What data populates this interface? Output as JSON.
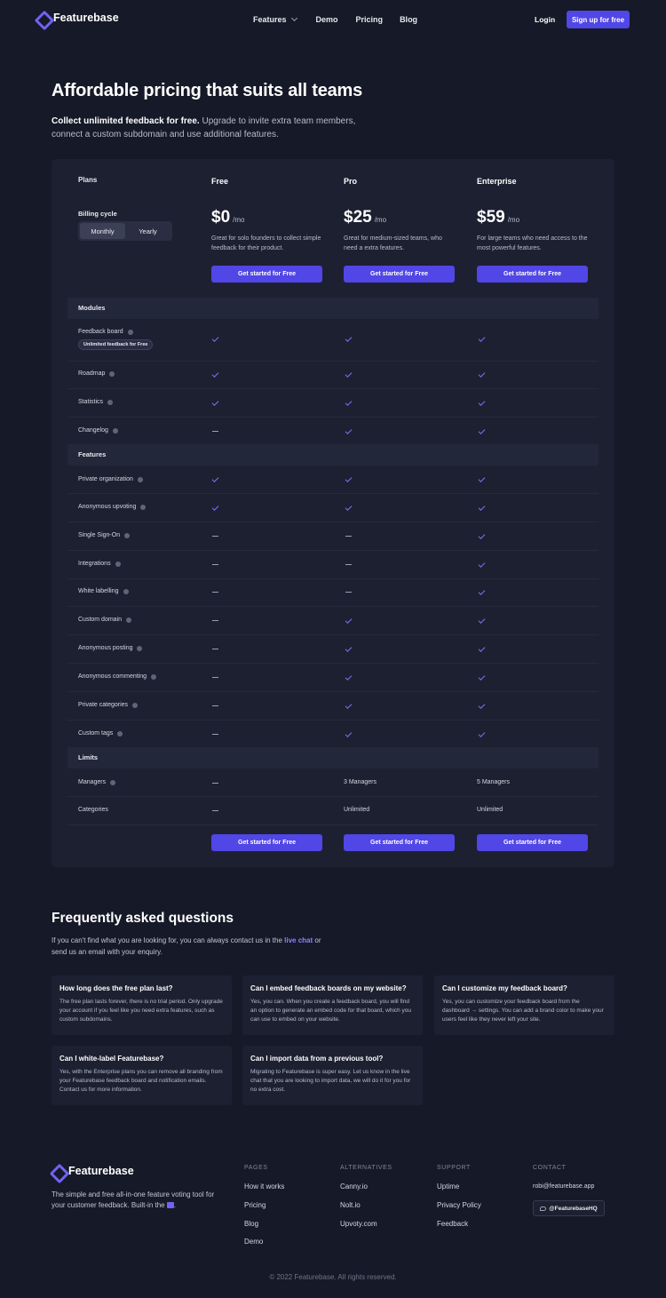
{
  "nav": {
    "brand": "Featurebase",
    "links": {
      "features": "Features",
      "demo": "Demo",
      "pricing": "Pricing",
      "blog": "Blog"
    },
    "login": "Login",
    "signup": "Sign up for free"
  },
  "hero": {
    "title": "Affordable pricing that suits all teams",
    "subtitle_bold": "Collect unlimited feedback for free.",
    "subtitle_rest": " Upgrade to invite extra team members, connect a custom subdomain and use additional features."
  },
  "pricing": {
    "plans_label": "Plans",
    "billing_label": "Billing cycle",
    "billing_options": [
      "Monthly",
      "Yearly"
    ],
    "plans": [
      {
        "name": "Free",
        "price": "$0",
        "period": "/mo",
        "desc": "Great for solo founders to collect simple feedback for their product.",
        "cta": "Get started for Free"
      },
      {
        "name": "Pro",
        "price": "$25",
        "period": "/mo",
        "desc": "Great for medium-sized teams, who need a extra features.",
        "cta": "Get started for Free"
      },
      {
        "name": "Enterprise",
        "price": "$59",
        "period": "/mo",
        "desc": "For large teams who need access to the most powerful features.",
        "cta": "Get started for Free"
      }
    ],
    "sections": [
      {
        "title": "Modules",
        "rows": [
          {
            "label": "Feedback board",
            "badge": "Unlimited feedback for Free",
            "values": [
              "check",
              "check",
              "check"
            ]
          },
          {
            "label": "Roadmap",
            "values": [
              "check",
              "check",
              "check"
            ]
          },
          {
            "label": "Statistics",
            "values": [
              "check",
              "check",
              "check"
            ]
          },
          {
            "label": "Changelog",
            "values": [
              "dash",
              "check",
              "check"
            ]
          }
        ]
      },
      {
        "title": "Features",
        "rows": [
          {
            "label": "Private organization",
            "values": [
              "check",
              "check",
              "check"
            ]
          },
          {
            "label": "Anonymous upvoting",
            "values": [
              "check",
              "check",
              "check"
            ]
          },
          {
            "label": "Single Sign-On",
            "values": [
              "dash",
              "dash",
              "check"
            ]
          },
          {
            "label": "Integrations",
            "values": [
              "dash",
              "dash",
              "check"
            ]
          },
          {
            "label": "White labelling",
            "values": [
              "dash",
              "dash",
              "check"
            ]
          },
          {
            "label": "Custom domain",
            "values": [
              "dash",
              "check",
              "check"
            ]
          },
          {
            "label": "Anonymous posting",
            "values": [
              "dash",
              "check",
              "check"
            ]
          },
          {
            "label": "Anonymous commenting",
            "values": [
              "dash",
              "check",
              "check"
            ]
          },
          {
            "label": "Private categories",
            "values": [
              "dash",
              "check",
              "check"
            ]
          },
          {
            "label": "Custom tags",
            "values": [
              "dash",
              "check",
              "check"
            ]
          }
        ]
      },
      {
        "title": "Limits",
        "rows": [
          {
            "label": "Managers",
            "values": [
              "dash",
              "3 Managers",
              "5 Managers"
            ]
          },
          {
            "label": "Categories",
            "values": [
              "dash",
              "Unlimited",
              "Unlimited"
            ]
          }
        ]
      }
    ],
    "bottom_cta": "Get started for Free"
  },
  "faq": {
    "title": "Frequently asked questions",
    "sub_before": "If you can't find what you are looking for, you can always contact us in the ",
    "sub_link": "live chat",
    "sub_after": " or send us an email with your enquiry.",
    "items": [
      {
        "q": "How long does the free plan last?",
        "a": "The free plan lasts forever, there is no trial period. Only upgrade your account if you feel like you need extra features, such as custom subdomains."
      },
      {
        "q": "Can I embed feedback boards on my website?",
        "a": "Yes, you can. When you create a feedback board, you will find an option to generate an embed code for that board, which you can use to embed on your website."
      },
      {
        "q": "Can I customize my feedback board?",
        "a": "Yes, you can customize your feedback board from the dashboard → settings. You can add a brand color to make your users feel like they never left your site."
      },
      {
        "q": "Can I white-label Featurebase?",
        "a": "Yes, with the Enterprise plans you can remove all branding from your Featurebase feedback board and notification emails. Contact us for more information."
      },
      {
        "q": "Can I import data from a previous tool?",
        "a": "Migrating to Featurebase is super easy. Let us know in the live chat that you are looking to import data, we will do it for you for no extra cost."
      }
    ]
  },
  "footer": {
    "brand": "Featurebase",
    "desc": "The simple and free all-in-one feature voting tool for your customer feedback. Built-in the",
    "desc_end": ".",
    "columns": [
      {
        "title": "PAGES",
        "links": [
          "How it works",
          "Pricing",
          "Blog",
          "Demo"
        ]
      },
      {
        "title": "ALTERNATIVES",
        "links": [
          "Canny.io",
          "Nolt.io",
          "Upvoty.com"
        ]
      },
      {
        "title": "SUPPORT",
        "links": [
          "Uptime",
          "Privacy Policy",
          "Feedback"
        ]
      }
    ],
    "contact_title": "CONTACT",
    "email": "robi@featurebase.app",
    "twitter": "@FeaturebaseHQ",
    "copyright": "© 2022 Featurebase. All rights reserved."
  },
  "colors": {
    "accent": "#5146e6",
    "background": "#161927",
    "card": "#1d2031"
  }
}
